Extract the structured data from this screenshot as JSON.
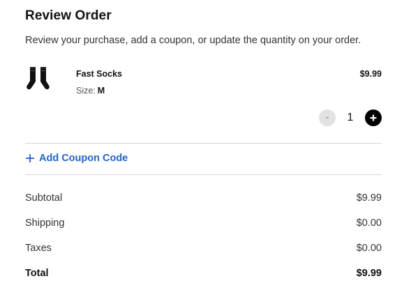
{
  "header": {
    "title": "Review Order",
    "subtitle": "Review your purchase, add a coupon, or update the quantity on your order."
  },
  "item": {
    "name": "Fast Socks",
    "size_label": "Size:",
    "size_value": "M",
    "price": "$9.99",
    "thumbnail_icon": "socks-icon",
    "quantity": "1",
    "minus_label": "-",
    "plus_icon": "plus-circle-icon"
  },
  "coupon": {
    "icon": "plus-icon",
    "label": "Add Coupon Code",
    "color": "#2563c9"
  },
  "summary": {
    "subtotal_label": "Subtotal",
    "subtotal_value": "$9.99",
    "shipping_label": "Shipping",
    "shipping_value": "$0.00",
    "taxes_label": "Taxes",
    "taxes_value": "$0.00",
    "total_label": "Total",
    "total_value": "$9.99"
  }
}
